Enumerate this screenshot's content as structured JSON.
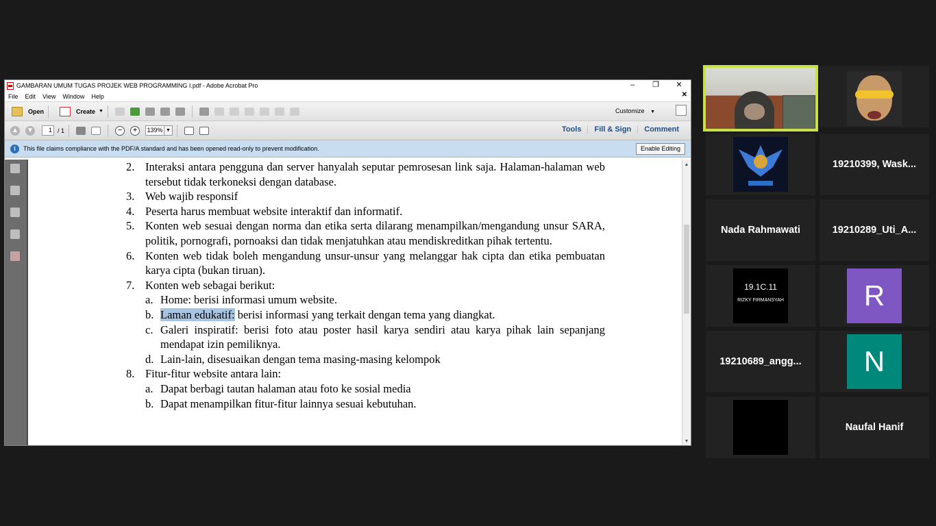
{
  "window": {
    "title": "GAMBARAN UMUM TUGAS PROJEK WEB PROGRAMMING I.pdf - Adobe Acrobat Pro",
    "controls": {
      "minimize": "–",
      "maximize": "❐",
      "close": "✕"
    }
  },
  "menu": {
    "items": [
      "File",
      "Edit",
      "View",
      "Window",
      "Help"
    ],
    "close_doc": "✕"
  },
  "toolbar": {
    "open_label": "Open",
    "create_label": "Create",
    "customize_label": "Customize"
  },
  "nav": {
    "page_current": "1",
    "page_total": "/ 1",
    "zoom": "139%",
    "tools_label": "Tools",
    "fill_sign_label": "Fill & Sign",
    "comment_label": "Comment"
  },
  "infobar": {
    "message": "This file claims compliance with the PDF/A standard and has been opened read-only to prevent modification.",
    "button_label": "Enable Editing"
  },
  "document": {
    "items": [
      {
        "num": "2.",
        "text": "Interaksi antara pengguna dan server hanyalah seputar pemrosesan link saja. Halaman-halaman web tersebut tidak terkoneksi dengan database."
      },
      {
        "num": "3.",
        "text": "Web wajib responsif"
      },
      {
        "num": "4.",
        "text": "Peserta harus membuat website interaktif dan informatif."
      },
      {
        "num": "5.",
        "text": "Konten web sesuai dengan norma dan etika serta dilarang menampilkan/mengandung unsur SARA, politik, pornografi, pornoaksi dan tidak menjatuhkan atau mendiskreditkan pihak tertentu."
      },
      {
        "num": "6.",
        "text": "Konten web tidak boleh mengandung unsur-unsur yang melanggar hak cipta dan etika pembuatan karya cipta (bukan tiruan)."
      },
      {
        "num": "7.",
        "text": "Konten web sebagai berikut:"
      }
    ],
    "sub7": [
      {
        "num": "a.",
        "text": "Home: berisi informasi umum website."
      },
      {
        "num": "b.",
        "highlight": "Laman edukatif:",
        "text": " berisi informasi yang terkait dengan tema yang diangkat."
      },
      {
        "num": "c.",
        "text": "Galeri inspiratif: berisi foto atau poster hasil karya sendiri atau karya pihak lain sepanjang mendapat izin pemiliknya."
      },
      {
        "num": "d.",
        "text": "Lain-lain, disesuaikan dengan tema masing-masing kelompok"
      }
    ],
    "item8": {
      "num": "8.",
      "text": "Fitur-fitur website antara lain:"
    },
    "sub8": [
      {
        "num": "a.",
        "text": "Dapat berbagi tautan halaman atau foto ke sosial media"
      },
      {
        "num": "b.",
        "text": "Dapat menampilkan fitur-fitur lainnya sesuai kebutuhan."
      }
    ]
  },
  "participants": {
    "p1_name": "19210399, Wask...",
    "p2_name": "Nada Rahmawati",
    "p3_name": "19210289_Uti_A...",
    "p4_avatar_line1": "19.1C.11",
    "p4_avatar_line2": "RIZKY FIRMANSYAH",
    "p5_initial": "R",
    "p6_name": "19210689_angg...",
    "p7_initial": "N",
    "p8_name": "Naufal Hanif",
    "colors": {
      "r_tile": "#7e57c2",
      "n_tile": "#00897b",
      "active_border": "#c8e04a"
    }
  }
}
